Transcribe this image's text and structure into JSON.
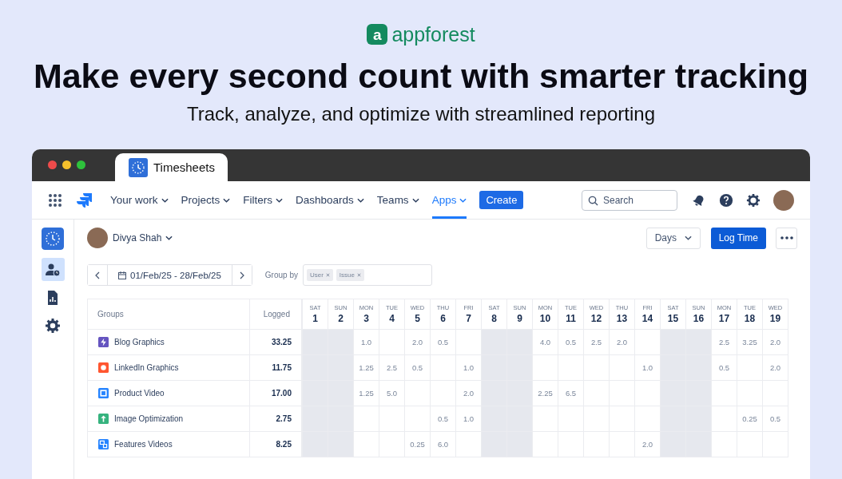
{
  "brand": {
    "name": "appforest",
    "mark": "a"
  },
  "headline": "Make every second count with smarter tracking",
  "subheadline": "Track, analyze, and optimize with streamlined reporting",
  "window": {
    "tab_title": "Timesheets"
  },
  "nav": [
    {
      "label": "Your work",
      "selected": false
    },
    {
      "label": "Projects",
      "selected": false
    },
    {
      "label": "Filters",
      "selected": false
    },
    {
      "label": "Dashboards",
      "selected": false
    },
    {
      "label": "Teams",
      "selected": false
    },
    {
      "label": "Apps",
      "selected": true
    }
  ],
  "create_button": "Create",
  "search": {
    "placeholder": "Search"
  },
  "sidebar": [
    {
      "selected": false
    },
    {
      "selected": true
    },
    {
      "selected": false
    },
    {
      "selected": false
    }
  ],
  "user": "Divya Shah",
  "view_select": "Days",
  "log_button": "Log Time",
  "date_range": "01/Feb/25 - 28/Feb/25",
  "group_by": {
    "label": "Group by",
    "chips": [
      "User",
      "Issue"
    ]
  },
  "table": {
    "columns": [
      "Groups",
      "Logged"
    ],
    "days": [
      {
        "weekday": "SAT",
        "day": "1",
        "weekend": true
      },
      {
        "weekday": "SUN",
        "day": "2",
        "weekend": true
      },
      {
        "weekday": "MON",
        "day": "3",
        "weekend": false
      },
      {
        "weekday": "TUE",
        "day": "4",
        "weekend": false
      },
      {
        "weekday": "WED",
        "day": "5",
        "weekend": false
      },
      {
        "weekday": "THU",
        "day": "6",
        "weekend": false
      },
      {
        "weekday": "FRI",
        "day": "7",
        "weekend": false
      },
      {
        "weekday": "SAT",
        "day": "8",
        "weekend": true
      },
      {
        "weekday": "SUN",
        "day": "9",
        "weekend": true
      },
      {
        "weekday": "MON",
        "day": "10",
        "weekend": false
      },
      {
        "weekday": "TUE",
        "day": "11",
        "weekend": false
      },
      {
        "weekday": "WED",
        "day": "12",
        "weekend": false
      },
      {
        "weekday": "THU",
        "day": "13",
        "weekend": false
      },
      {
        "weekday": "FRI",
        "day": "14",
        "weekend": false
      },
      {
        "weekday": "SAT",
        "day": "15",
        "weekend": true
      },
      {
        "weekday": "SUN",
        "day": "16",
        "weekend": true
      },
      {
        "weekday": "MON",
        "day": "17",
        "weekend": false
      },
      {
        "weekday": "TUE",
        "day": "18",
        "weekend": false
      },
      {
        "weekday": "WED",
        "day": "19",
        "weekend": false
      }
    ],
    "rows": [
      {
        "name": "Blog Graphics",
        "color": "#6554c0",
        "logged": "33.25",
        "cells": [
          null,
          null,
          "1.0",
          null,
          "2.0",
          "0.5",
          null,
          null,
          null,
          "4.0",
          "0.5",
          "2.5",
          "2.0",
          null,
          null,
          null,
          "2.5",
          "3.25",
          "2.0"
        ]
      },
      {
        "name": "LinkedIn Graphics",
        "color": "#ff5630",
        "logged": "11.75",
        "cells": [
          null,
          null,
          "1.25",
          "2.5",
          "0.5",
          null,
          "1.0",
          null,
          null,
          null,
          null,
          null,
          null,
          "1.0",
          null,
          null,
          "0.5",
          null,
          "2.0"
        ]
      },
      {
        "name": "Product Video",
        "color": "#2684ff",
        "logged": "17.00",
        "cells": [
          null,
          null,
          "1.25",
          "5.0",
          null,
          null,
          "2.0",
          null,
          null,
          "2.25",
          "6.5",
          null,
          null,
          null,
          null,
          null,
          null,
          null,
          null
        ]
      },
      {
        "name": "Image Optimization",
        "color": "#36b37e",
        "logged": "2.75",
        "cells": [
          null,
          null,
          null,
          null,
          null,
          "0.5",
          "1.0",
          null,
          null,
          null,
          null,
          null,
          null,
          null,
          null,
          null,
          null,
          "0.25",
          "0.5"
        ]
      },
      {
        "name": "Features Videos",
        "color": "#2684ff",
        "logged": "8.25",
        "cells": [
          null,
          null,
          null,
          null,
          "0.25",
          "6.0",
          null,
          null,
          null,
          null,
          null,
          null,
          null,
          "2.0",
          null,
          null,
          null,
          null,
          null
        ]
      }
    ]
  }
}
